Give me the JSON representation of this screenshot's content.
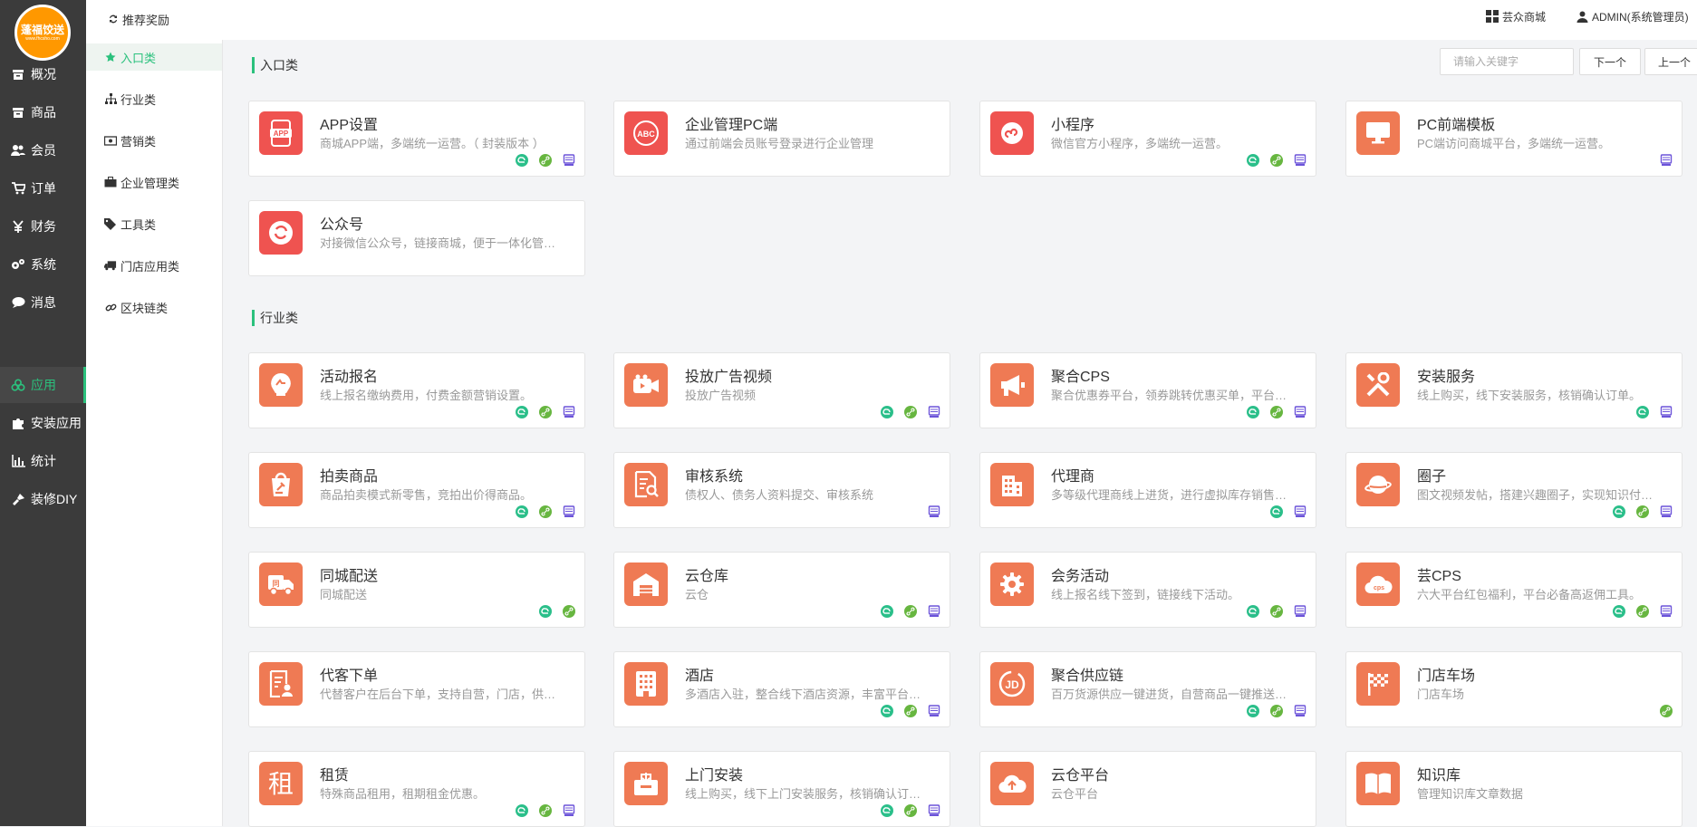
{
  "colors": {
    "accent": "#2bc17d",
    "sidebar_bg": "#3b3b3b",
    "icon_red": "#ef5350",
    "icon_orange": "#ef7a54",
    "platform_mp": "#2bbf8a",
    "platform_link": "#67b640",
    "platform_pc": "#6c54d9"
  },
  "logo": {
    "text": "蓬福饺送",
    "sub": "www.fhcsho.com"
  },
  "sidebar": {
    "items": [
      {
        "label": "概况",
        "icon": "box-icon"
      },
      {
        "label": "商品",
        "icon": "box-icon"
      },
      {
        "label": "会员",
        "icon": "users-icon"
      },
      {
        "label": "订单",
        "icon": "cart-icon"
      },
      {
        "label": "财务",
        "icon": "yen-icon"
      },
      {
        "label": "系统",
        "icon": "gears-icon"
      },
      {
        "label": "消息",
        "icon": "chat-icon"
      },
      {
        "label": "应用",
        "icon": "cubes-icon",
        "active": true
      },
      {
        "label": "安装应用",
        "icon": "puzzle-icon"
      },
      {
        "label": "统计",
        "icon": "bar-chart-icon"
      },
      {
        "label": "装修DIY",
        "icon": "brush-icon"
      }
    ]
  },
  "subnav": {
    "header": "推荐奖励",
    "items": [
      {
        "label": "入口类",
        "icon": "star-icon",
        "active": true
      },
      {
        "label": "行业类",
        "icon": "sitemap-icon"
      },
      {
        "label": "营销类",
        "icon": "money-icon"
      },
      {
        "label": "企业管理类",
        "icon": "briefcase-icon"
      },
      {
        "label": "工具类",
        "icon": "tags-icon"
      },
      {
        "label": "门店应用类",
        "icon": "truck-icon"
      },
      {
        "label": "区块链类",
        "icon": "link-icon"
      }
    ]
  },
  "header": {
    "store_label": "芸众商城",
    "user_label": "ADMIN(系统管理员)"
  },
  "search": {
    "placeholder": "请输入关键字",
    "next_label": "下一个",
    "prev_label": "上一个"
  },
  "sections": [
    {
      "title": "入口类",
      "cards": [
        {
          "title": "APP设置",
          "desc": "商城APP端，多端统一运营。（ 封装版本 ）",
          "icon": "app-phone-icon",
          "color": "red",
          "platforms": [
            "mp",
            "link",
            "pc"
          ]
        },
        {
          "title": "企业管理PC端",
          "desc": "通过前端会员账号登录进行企业管理",
          "icon": "abc-icon",
          "color": "red",
          "platforms": []
        },
        {
          "title": "小程序",
          "desc": "微信官方小程序，多端统一运营。",
          "icon": "miniprogram-icon",
          "color": "red",
          "platforms": [
            "mp",
            "link",
            "pc"
          ]
        },
        {
          "title": "PC前端模板",
          "desc": "PC端访问商城平台，多端统一运营。",
          "icon": "monitor-icon",
          "color": "orange",
          "platforms": [
            "pc"
          ]
        },
        {
          "title": "公众号",
          "desc": "对接微信公众号，链接商城，便于一体化管理会员。",
          "icon": "wechat-icon",
          "color": "red",
          "platforms": []
        }
      ]
    },
    {
      "title": "行业类",
      "cards": [
        {
          "title": "活动报名",
          "desc": "线上报名缴纳费用，付费金额营销设置。",
          "icon": "signup-icon",
          "color": "orange",
          "platforms": [
            "mp",
            "link",
            "pc"
          ]
        },
        {
          "title": "投放广告视频",
          "desc": "投放广告视频",
          "icon": "video-icon",
          "color": "orange",
          "platforms": [
            "mp",
            "link",
            "pc"
          ]
        },
        {
          "title": "聚合CPS",
          "desc": "聚合优惠券平台，领券跳转优惠买单，平台会员享受佣金返利。",
          "icon": "megaphone-icon",
          "color": "orange",
          "platforms": [
            "mp",
            "link",
            "pc"
          ]
        },
        {
          "title": "安装服务",
          "desc": "线上购买，线下安装服务，核销确认订单。",
          "icon": "tools-icon",
          "color": "orange",
          "platforms": [
            "mp",
            "pc"
          ]
        },
        {
          "title": "拍卖商品",
          "desc": "商品拍卖模式新零售，竞拍出价得商品。",
          "icon": "auction-icon",
          "color": "orange",
          "platforms": [
            "mp",
            "link",
            "pc"
          ]
        },
        {
          "title": "审核系统",
          "desc": "债权人、债务人资料提交、审核系统",
          "icon": "audit-icon",
          "color": "orange",
          "platforms": [
            "pc"
          ]
        },
        {
          "title": "代理商",
          "desc": "多等级代理商线上进货，进行虚拟库存销售管理系统。",
          "icon": "building-icon",
          "color": "orange",
          "platforms": [
            "mp",
            "pc"
          ]
        },
        {
          "title": "圈子",
          "desc": "图文视频发帖，搭建兴趣圈子，实现知识付费。",
          "icon": "planet-icon",
          "color": "orange",
          "platforms": [
            "mp",
            "link",
            "pc"
          ]
        },
        {
          "title": "同城配送",
          "desc": "同城配送",
          "icon": "delivery-truck-icon",
          "color": "orange",
          "platforms": [
            "mp",
            "link"
          ]
        },
        {
          "title": "云仓库",
          "desc": "云仓",
          "icon": "warehouse-icon",
          "color": "orange",
          "platforms": [
            "mp",
            "link",
            "pc"
          ]
        },
        {
          "title": "会务活动",
          "desc": "线上报名线下签到，链接线下活动。",
          "icon": "gear-icon",
          "color": "orange",
          "platforms": [
            "mp",
            "link",
            "pc"
          ]
        },
        {
          "title": "芸CPS",
          "desc": "六大平台红包福利，平台必备高返佣工具。",
          "icon": "cloud-cps-icon",
          "color": "orange",
          "platforms": [
            "mp",
            "link",
            "pc"
          ]
        },
        {
          "title": "代客下单",
          "desc": "代替客户在后台下单，支持自营，门店，供应商商品下单。",
          "icon": "proxy-order-icon",
          "color": "orange",
          "platforms": []
        },
        {
          "title": "酒店",
          "desc": "多酒店入驻，整合线下酒店资源，丰富平台服务类目。",
          "icon": "hotel-icon",
          "color": "orange",
          "platforms": [
            "mp",
            "link",
            "pc"
          ]
        },
        {
          "title": "聚合供应链",
          "desc": "百万货源供应一键进货，自营商品一键推送云仓平台。",
          "icon": "jd-icon",
          "color": "orange",
          "platforms": [
            "mp",
            "link",
            "pc"
          ]
        },
        {
          "title": "门店车场",
          "desc": "门店车场",
          "icon": "flag-icon",
          "color": "orange",
          "platforms": [
            "link"
          ]
        },
        {
          "title": "租赁",
          "desc": "特殊商品租用，租期租金优惠。",
          "icon": "rent-icon",
          "color": "orange",
          "platforms": [
            "mp",
            "link",
            "pc"
          ]
        },
        {
          "title": "上门安装",
          "desc": "线上购买，线下上门安装服务，核销确认订单。",
          "icon": "install-box-icon",
          "color": "orange",
          "platforms": [
            "mp",
            "link",
            "pc"
          ]
        },
        {
          "title": "云仓平台",
          "desc": "云仓平台",
          "icon": "cloud-upload-icon",
          "color": "orange",
          "platforms": []
        },
        {
          "title": "知识库",
          "desc": "管理知识库文章数据",
          "icon": "book-icon",
          "color": "orange",
          "platforms": []
        }
      ]
    }
  ]
}
